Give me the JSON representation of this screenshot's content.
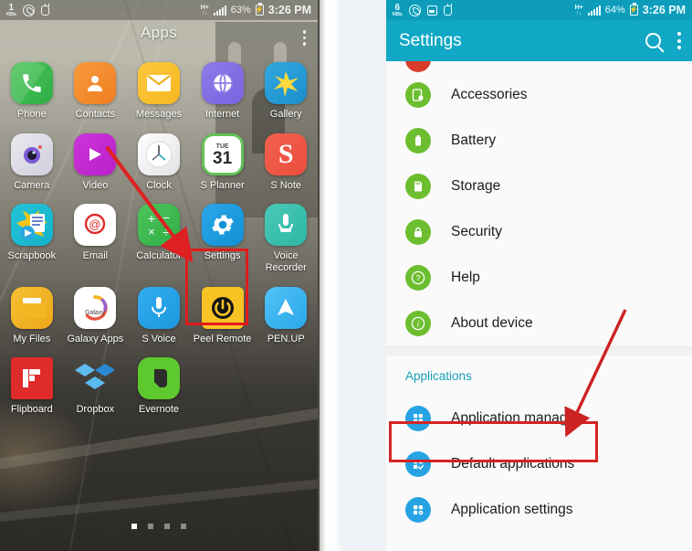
{
  "left_panel": {
    "status_bar": {
      "data_rate_value": "1",
      "data_rate_unit": "KB/s",
      "icons": [
        "viber-icon",
        "plug-icon"
      ],
      "network_type": "H+",
      "signal": "signal-bars-icon",
      "battery_percent": "63%",
      "battery_state": "charging",
      "time": "3:26 PM"
    },
    "title": "Apps",
    "menu_icon": "overflow-menu-icon",
    "apps": [
      {
        "label": "Phone",
        "icon": "phone-icon"
      },
      {
        "label": "Contacts",
        "icon": "contacts-icon"
      },
      {
        "label": "Messages",
        "icon": "messages-icon"
      },
      {
        "label": "Internet",
        "icon": "internet-icon"
      },
      {
        "label": "Gallery",
        "icon": "gallery-icon"
      },
      {
        "label": "Camera",
        "icon": "camera-icon"
      },
      {
        "label": "Video",
        "icon": "video-icon"
      },
      {
        "label": "Clock",
        "icon": "clock-icon"
      },
      {
        "label": "S Planner",
        "icon": "calendar-icon",
        "day": "TUE",
        "date": "31"
      },
      {
        "label": "S Note",
        "icon": "snote-icon"
      },
      {
        "label": "Scrapbook",
        "icon": "scrapbook-icon"
      },
      {
        "label": "Email",
        "icon": "email-icon"
      },
      {
        "label": "Calculator",
        "icon": "calculator-icon"
      },
      {
        "label": "Settings",
        "icon": "settings-gear-icon"
      },
      {
        "label": "Voice Recorder",
        "icon": "microphone-icon"
      },
      {
        "label": "My Files",
        "icon": "folder-icon"
      },
      {
        "label": "Galaxy Apps",
        "icon": "galaxy-apps-icon"
      },
      {
        "label": "S Voice",
        "icon": "svoice-microphone-icon"
      },
      {
        "label": "Peel Remote",
        "icon": "power-icon"
      },
      {
        "label": "PEN.UP",
        "icon": "penup-icon"
      },
      {
        "label": "Flipboard",
        "icon": "flipboard-icon"
      },
      {
        "label": "Dropbox",
        "icon": "dropbox-icon"
      },
      {
        "label": "Evernote",
        "icon": "evernote-icon"
      }
    ],
    "page_dots": {
      "count": 4,
      "active_index": 0
    },
    "highlight": {
      "target": "Settings",
      "color": "#e01b1b"
    },
    "arrow": {
      "color": "#e01b1b",
      "points_to": "Settings"
    }
  },
  "right_panel": {
    "status_bar": {
      "data_rate_value": "6",
      "data_rate_unit": "KB/s",
      "icons": [
        "viber-icon",
        "screenshot-icon",
        "plug-icon"
      ],
      "network_type": "H+",
      "signal": "signal-bars-icon",
      "battery_percent": "64%",
      "battery_state": "charging",
      "time": "3:26 PM"
    },
    "action_bar": {
      "title": "Settings",
      "search_icon": "search-icon",
      "menu_icon": "overflow-menu-icon"
    },
    "items": [
      {
        "label": "Accessories",
        "icon": "accessories-icon",
        "color": "green"
      },
      {
        "label": "Battery",
        "icon": "battery-icon",
        "color": "green"
      },
      {
        "label": "Storage",
        "icon": "storage-icon",
        "color": "green"
      },
      {
        "label": "Security",
        "icon": "lock-icon",
        "color": "green"
      },
      {
        "label": "Help",
        "icon": "help-icon",
        "color": "green"
      },
      {
        "label": "About device",
        "icon": "info-icon",
        "color": "green"
      }
    ],
    "section_header": "Applications",
    "application_items": [
      {
        "label": "Application manager",
        "icon": "app-grid-icon",
        "color": "blue"
      },
      {
        "label": "Default applications",
        "icon": "app-grid-check-icon",
        "color": "blue"
      },
      {
        "label": "Application settings",
        "icon": "app-grid-gear-icon",
        "color": "blue"
      }
    ],
    "highlight": {
      "target": "Application manager",
      "color": "#d42424"
    },
    "arrow": {
      "color": "#d42424",
      "points_to": "Application manager"
    }
  },
  "theme": {
    "accent_teal": "#10a8c4",
    "status_teal": "#0d9dbb",
    "green_icon": "#6cbe2f",
    "blue_icon": "#27a3e3",
    "highlight_red": "#e01b1b",
    "section_label": "#1a9fbb"
  }
}
